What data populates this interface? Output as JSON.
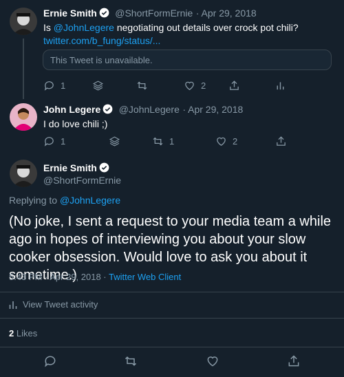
{
  "tweet1": {
    "name": "Ernie Smith",
    "handle": "@ShortFormErnie",
    "date": "· Apr 29, 2018",
    "text_prefix": "Is ",
    "mention": "@JohnLegere",
    "text_rest": " negotiating out details over crock pot chili?",
    "link": "twitter.com/b_fung/status/...",
    "quoted": "This Tweet is unavailable.",
    "replies": "1",
    "retweets": "",
    "likes": "2"
  },
  "tweet2": {
    "name": "John Legere",
    "handle": "@JohnLegere",
    "date": "· Apr 29, 2018",
    "text": "I do love chili ;)",
    "replies": "1",
    "retweets": "1",
    "likes": "2"
  },
  "main": {
    "name": "Ernie Smith",
    "handle": "@ShortFormErnie",
    "replying_prefix": "Replying to ",
    "replying_to": "@JohnLegere",
    "text": "(No joke, I sent a request to your media team a while ago in hopes of interviewing you about your slow cooker obsession. Would love to ask you about it sometime.)",
    "timestamp": "5:43 PM · Apr 29, 2018 · ",
    "client": "Twitter Web Client",
    "activity": "View Tweet activity",
    "likes_count": "2",
    "likes_label": "Likes"
  },
  "colors": {
    "background": "#15202b",
    "secondary_text": "#8899a6",
    "link": "#1da1f2",
    "border": "#38444d"
  },
  "icons": [
    "reply-icon",
    "retweet-icon",
    "like-icon",
    "share-icon",
    "analytics-icon",
    "stack-icon",
    "verified-icon"
  ]
}
